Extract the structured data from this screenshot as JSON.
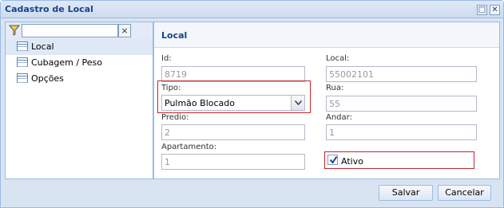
{
  "window": {
    "title": "Cadastro de Local"
  },
  "filter": {
    "value": "",
    "placeholder": "",
    "clear_label": "×"
  },
  "nav": {
    "items": [
      {
        "label": "Local"
      },
      {
        "label": "Cubagem / Peso"
      },
      {
        "label": "Opções"
      }
    ]
  },
  "panel": {
    "title": "Local"
  },
  "fields": {
    "id": {
      "label": "Id:",
      "value": "8719"
    },
    "local": {
      "label": "Local:",
      "value": "55002101"
    },
    "tipo": {
      "label": "Tipo:",
      "value": "Pulmão Blocado"
    },
    "rua": {
      "label": "Rua:",
      "value": "55"
    },
    "predio": {
      "label": "Predio:",
      "value": "2"
    },
    "andar": {
      "label": "Andar:",
      "value": "1"
    },
    "apartamento": {
      "label": "Apartamento:",
      "value": "1"
    },
    "ativo": {
      "label": "Ativo",
      "checked": true
    }
  },
  "buttons": {
    "save": "Salvar",
    "cancel": "Cancelar"
  },
  "colors": {
    "highlight_border": "#c0272d",
    "title_text": "#15428b"
  },
  "icons": {
    "filter": "filter-icon",
    "maximize": "maximize-icon",
    "close": "close-icon",
    "nav": "table-icon"
  }
}
